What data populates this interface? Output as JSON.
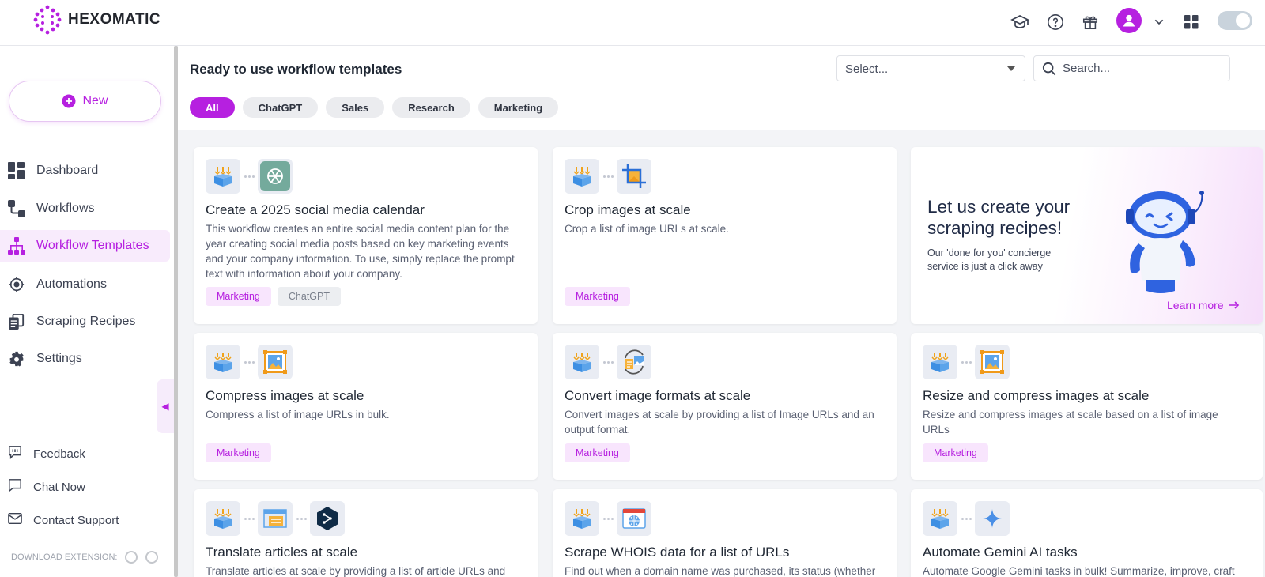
{
  "app": {
    "name": "HEXOMATIC"
  },
  "colors": {
    "accent": "#b620e0"
  },
  "topbar": {
    "icons": [
      "academy-icon",
      "help-icon",
      "gift-icon",
      "avatar-icon",
      "chevron-down-icon",
      "apps-grid-icon",
      "theme-toggle"
    ]
  },
  "sidebar": {
    "new_label": "New",
    "items": [
      {
        "label": "Dashboard",
        "icon": "dashboard-icon"
      },
      {
        "label": "Workflows",
        "icon": "workflows-icon"
      },
      {
        "label": "Workflow Templates",
        "icon": "workflow-templates-icon",
        "active": true
      },
      {
        "label": "Automations",
        "icon": "automations-icon"
      },
      {
        "label": "Scraping Recipes",
        "icon": "scraping-recipes-icon"
      },
      {
        "label": "Settings",
        "icon": "gear-icon"
      }
    ],
    "bottom": [
      {
        "label": "Feedback",
        "icon": "feedback-icon"
      },
      {
        "label": "Chat Now",
        "icon": "chat-icon"
      },
      {
        "label": "Contact Support",
        "icon": "mail-icon"
      }
    ],
    "download_extension": "DOWNLOAD EXTENSION:"
  },
  "main": {
    "title": "Ready to use workflow templates",
    "select_placeholder": "Select...",
    "search_placeholder": "Search...",
    "chips": [
      "All",
      "ChatGPT",
      "Sales",
      "Research",
      "Marketing"
    ]
  },
  "cards": [
    {
      "title": "Create a 2025 social media calendar",
      "desc": "This workflow creates an entire social media content plan for the year creating social media posts based on key marketing events and your company information. To use, simply replace the prompt text with information about your company.",
      "tags": [
        "Marketing",
        "ChatGPT"
      ]
    },
    {
      "title": "Crop images at scale",
      "desc": "Crop a list of image URLs at scale.",
      "tags": [
        "Marketing"
      ]
    },
    {
      "title": "Compress images at scale",
      "desc": "Compress a list of image URLs in bulk.",
      "tags": [
        "Marketing"
      ]
    },
    {
      "title": "Convert image formats at scale",
      "desc": "Convert images at scale by providing a list of Image URLs and an output format.",
      "tags": [
        "Marketing"
      ]
    },
    {
      "title": "Resize and compress images at scale",
      "desc": "Resize and compress images at scale based on a list of image URLs",
      "tags": [
        "Marketing"
      ]
    },
    {
      "title": "Translate articles at scale",
      "desc": "Translate articles at scale by providing a list of article URLs and"
    },
    {
      "title": "Scrape WHOIS data for a list of URLs",
      "desc": "Find out when a domain name was purchased, its status (whether"
    },
    {
      "title": "Automate Gemini AI tasks",
      "desc": "Automate Google Gemini tasks in bulk! Summarize, improve, craft"
    }
  ],
  "promo": {
    "title": "Let us create your scraping recipes!",
    "subtitle": "Our 'done for you' concierge service is just a click away",
    "link": "Learn more"
  }
}
